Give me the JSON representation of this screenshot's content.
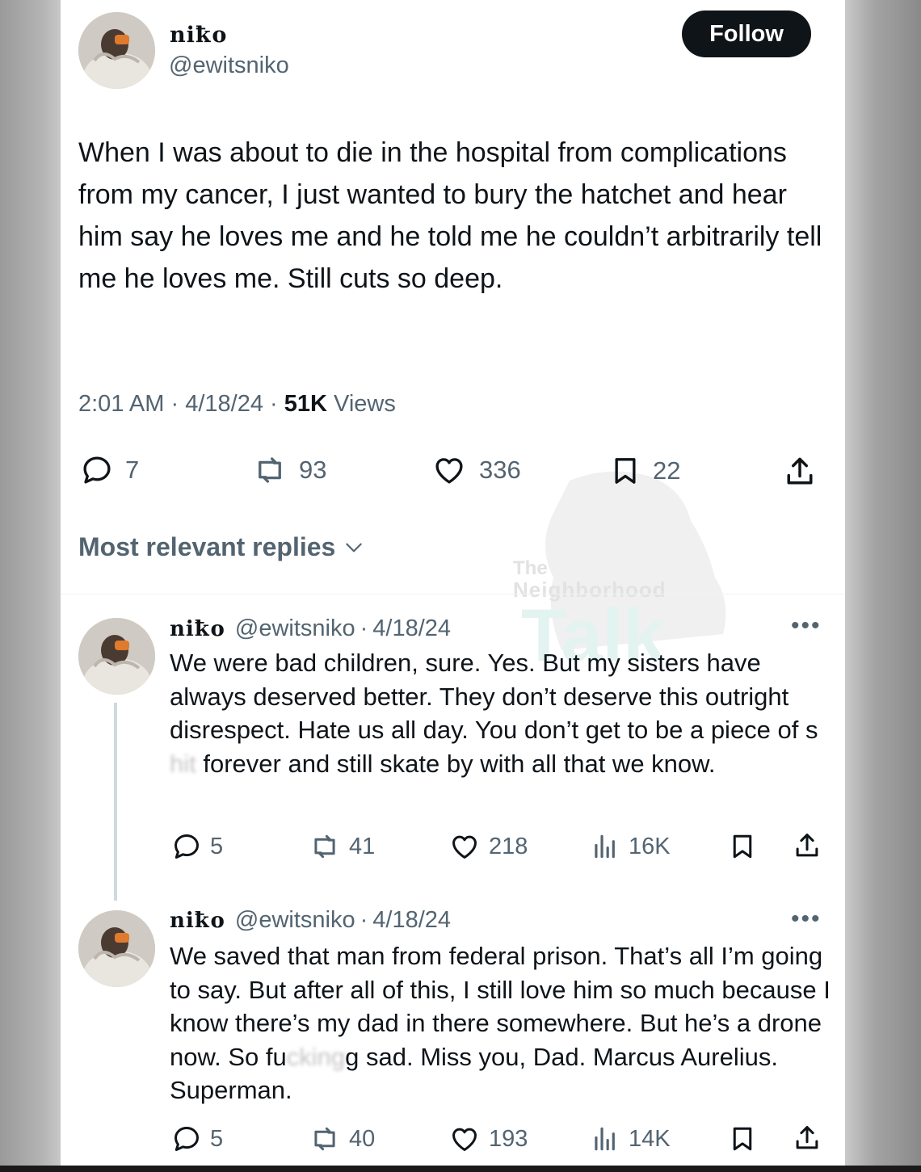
{
  "post": {
    "display_name": "niꝁo",
    "handle": "@ewitsniko",
    "follow_label": "Follow",
    "text": "When I was about to die in the hospital from complications from my cancer, I just wanted to bury the hatchet and hear him say he loves me and he told me he couldn’t arbitrarily tell me he loves me. Still cuts so deep.",
    "time": "2:01 AM",
    "date": "4/18/24",
    "views_count": "51K",
    "views_label": "Views",
    "sep": "·",
    "stats": {
      "replies": "7",
      "reposts": "93",
      "likes": "336",
      "bookmarks": "22"
    }
  },
  "replies_section": {
    "label": "Most relevant replies"
  },
  "watermark": {
    "line1": "The",
    "line2": "Neighborhood",
    "line3": "Talk"
  },
  "replies": [
    {
      "display_name": "niꝁo",
      "handle": "@ewitsniko",
      "date": "4/18/24",
      "text_before": "We were bad children, sure. Yes. But my sisters have always deserved better. They don’t deserve this outright disrespect. Hate us all day. You don’t get to be a piece of s",
      "censored": "hit",
      "text_after": " forever and still skate by with all that we know.",
      "stats": {
        "replies": "5",
        "reposts": "41",
        "likes": "218",
        "views": "16K"
      }
    },
    {
      "display_name": "niꝁo",
      "handle": "@ewitsniko",
      "date": "4/18/24",
      "text_before": "We saved that man from federal prison. That’s all I’m going to say. But after all of this, I still love him so much because I know there’s my dad in there somewhere. But he’s a drone now. So fu",
      "censored": "cking",
      "text_after": "g sad. Miss you, Dad. Marcus Aurelius. Superman.",
      "stats": {
        "replies": "5",
        "reposts": "40",
        "likes": "193",
        "views": "14K"
      }
    }
  ],
  "icons": [
    "reply-icon",
    "repost-icon",
    "like-icon",
    "bookmark-icon",
    "share-icon",
    "views-icon",
    "chevron-down-icon",
    "more-icon"
  ],
  "colors": {
    "text": "#0f1419",
    "secondary": "#536471",
    "follow_bg": "#0f1419",
    "divider": "#eff3f4"
  }
}
